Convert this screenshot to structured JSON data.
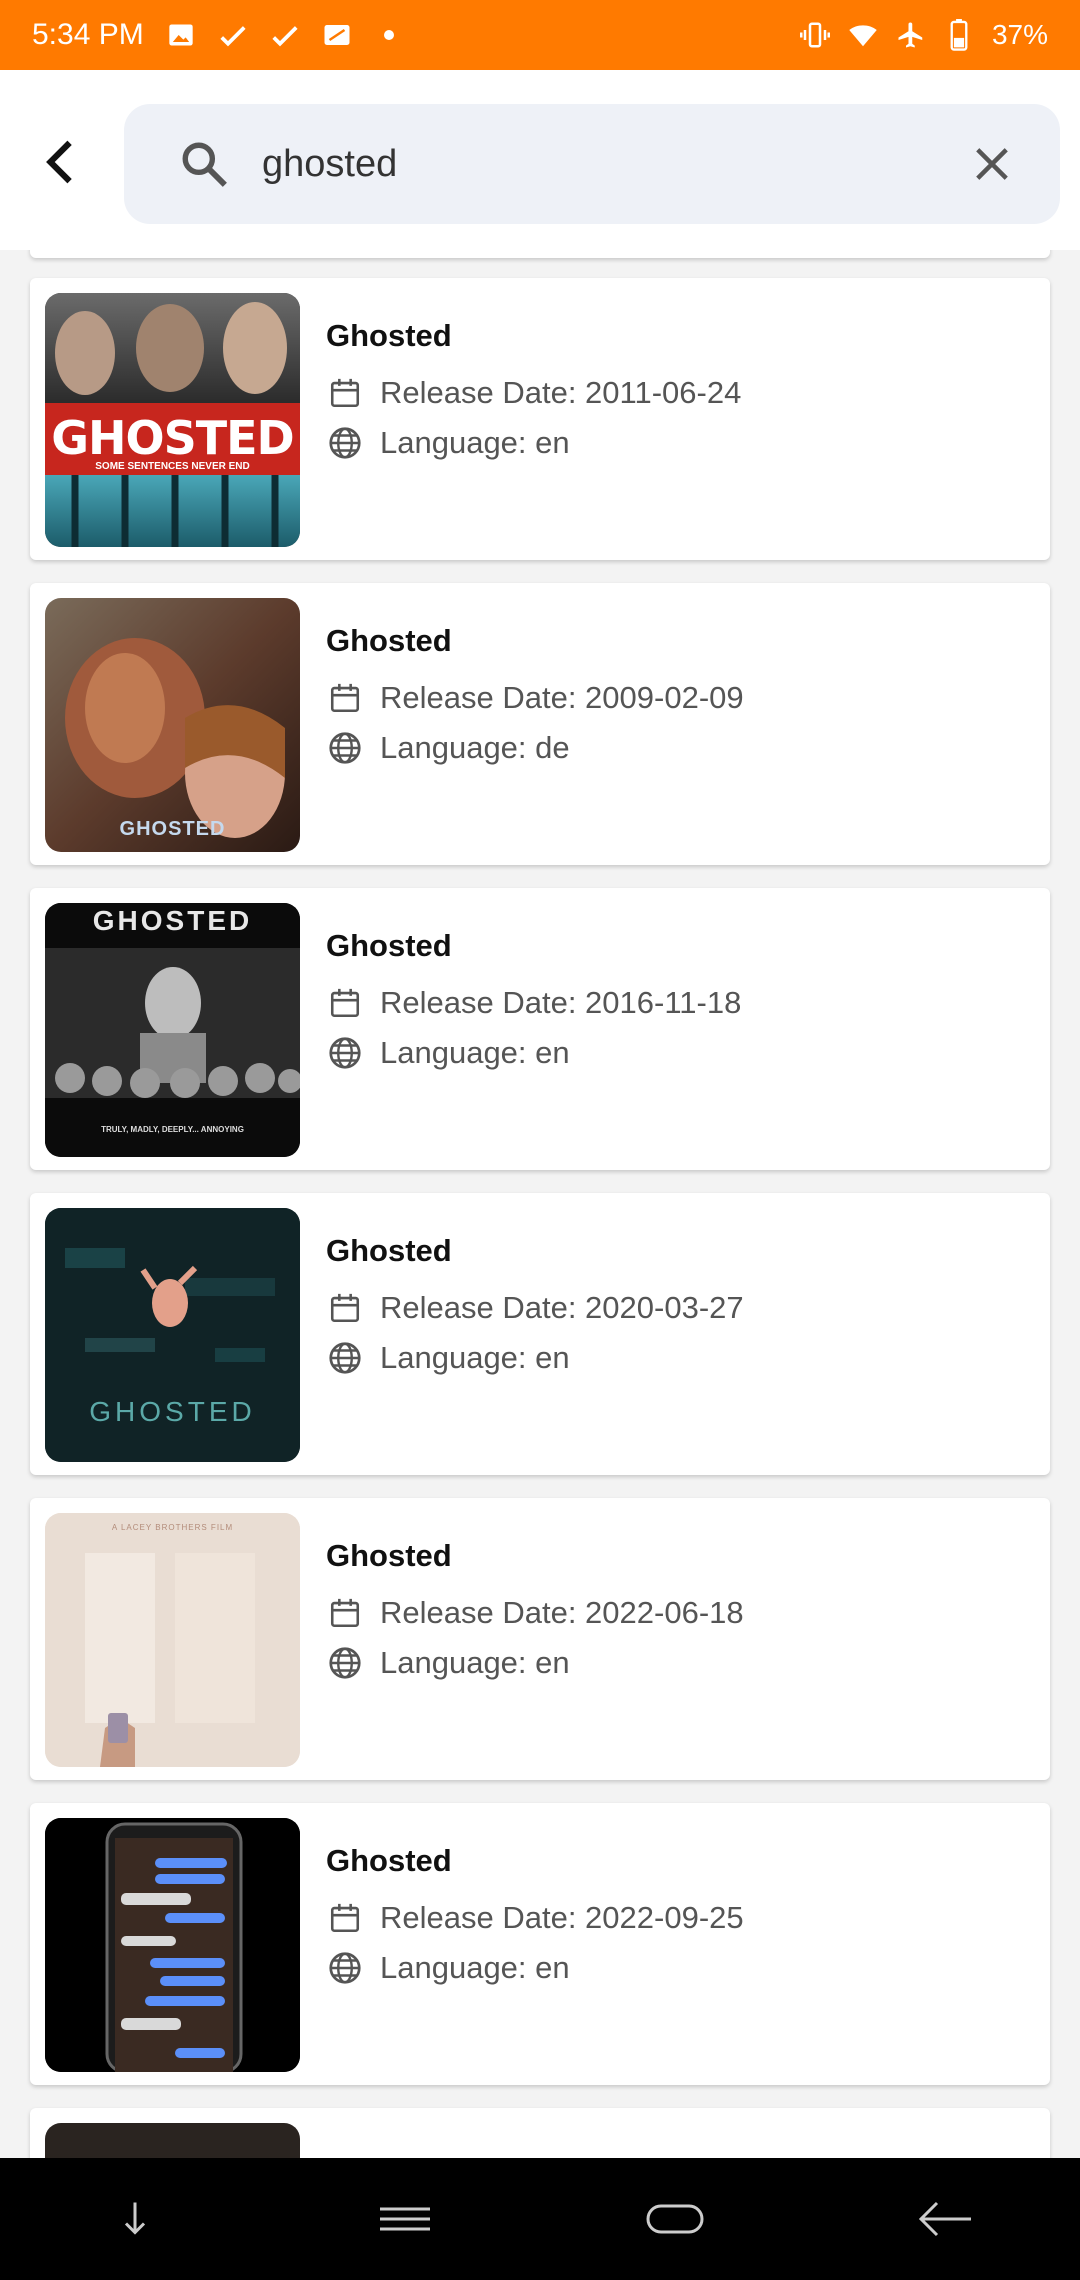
{
  "status_bar": {
    "time": "5:34 PM",
    "battery": "37%",
    "icons_left": [
      "image-icon",
      "check-icon",
      "check-icon",
      "cast-icon",
      "dot-icon"
    ],
    "icons_right": [
      "vibrate-icon",
      "wifi-icon",
      "airplane-icon",
      "battery-icon"
    ]
  },
  "header": {
    "back_icon": "chevron-left-icon",
    "search_value": "ghosted",
    "search_icon": "search-icon",
    "clear_icon": "close-icon"
  },
  "results": [
    {
      "title": "Ghosted",
      "release_label": "Release Date: 2011-06-24",
      "language_label": "Language: en",
      "poster_text": "GHOSTED",
      "poster_sub": "SOME SENTENCES NEVER END"
    },
    {
      "title": "Ghosted",
      "release_label": "Release Date: 2009-02-09",
      "language_label": "Language: de",
      "poster_text": "GHOSTED"
    },
    {
      "title": "Ghosted",
      "release_label": "Release Date: 2016-11-18",
      "language_label": "Language: en",
      "poster_text": "GHOSTED",
      "poster_sub": "TRULY, MADLY, DEEPLY... ANNOYING"
    },
    {
      "title": "Ghosted",
      "release_label": "Release Date: 2020-03-27",
      "language_label": "Language: en",
      "poster_text": "GHOSTED"
    },
    {
      "title": "Ghosted",
      "release_label": "Release Date: 2022-06-18",
      "language_label": "Language: en",
      "poster_text": "A LACEY BROTHERS FILM"
    },
    {
      "title": "Ghosted",
      "release_label": "Release Date: 2022-09-25",
      "language_label": "Language: en"
    }
  ],
  "nav": [
    "down-arrow-icon",
    "menu-icon",
    "home-pill-icon",
    "back-arrow-icon"
  ],
  "colors": {
    "accent": "#ff7a00",
    "card": "#ffffff",
    "background": "#f3f3f3"
  }
}
